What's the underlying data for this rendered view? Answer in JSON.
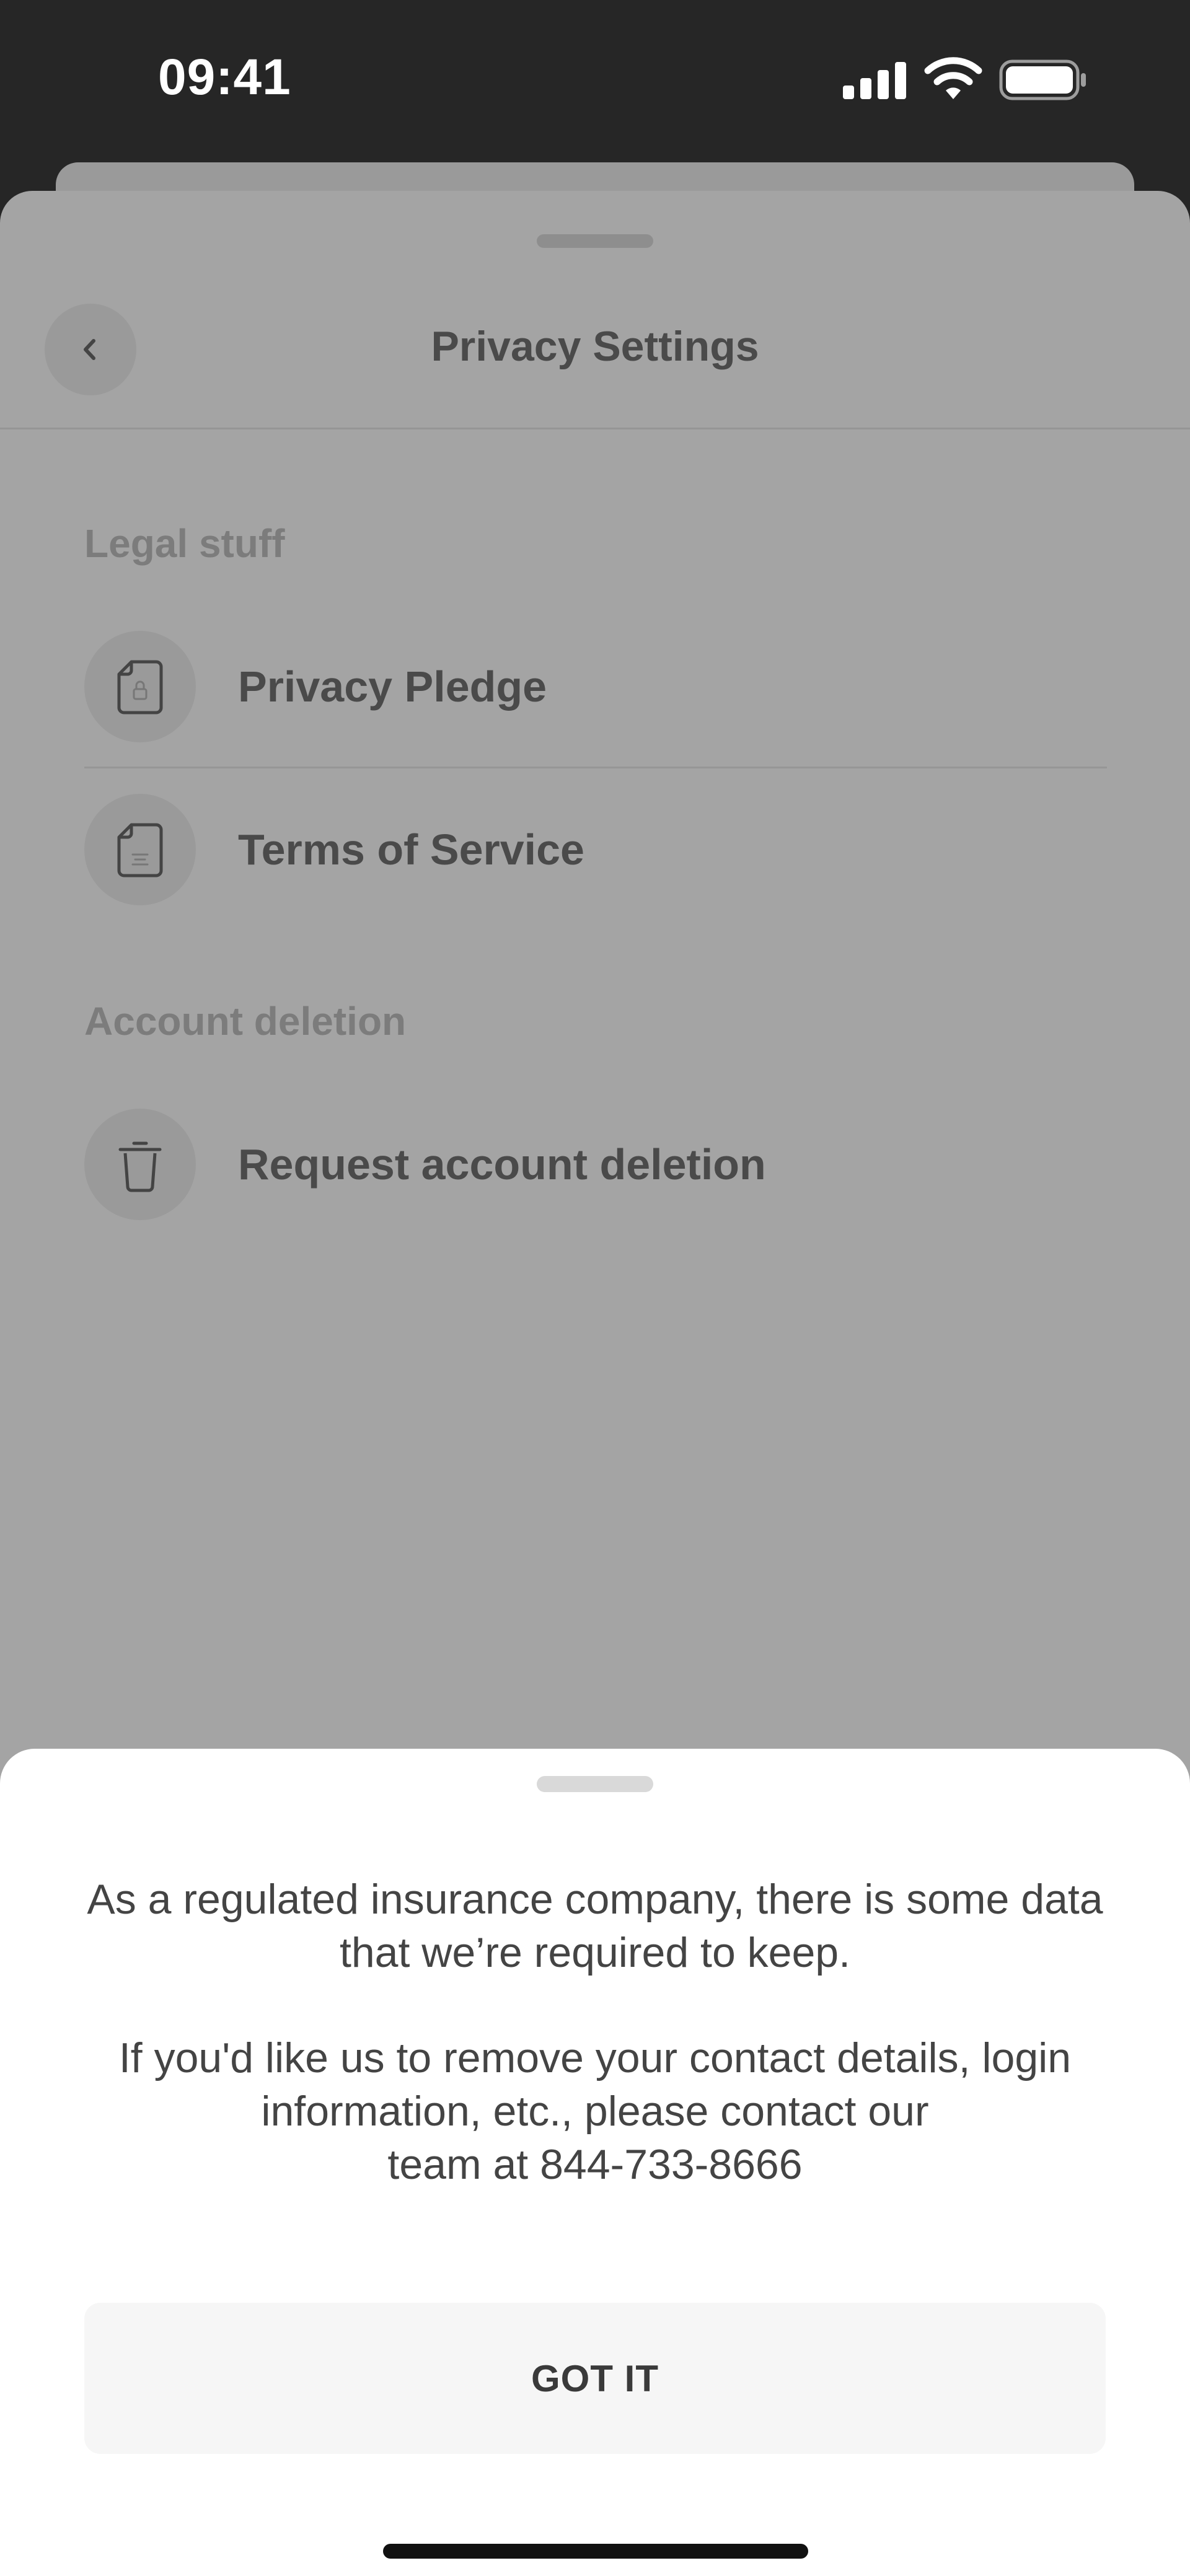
{
  "status_bar": {
    "time": "09:41",
    "icons": [
      "signal-icon",
      "wifi-icon",
      "battery-icon"
    ]
  },
  "header": {
    "back_icon": "chevron-left-icon",
    "title": "Privacy Settings"
  },
  "sections": [
    {
      "heading": "Legal stuff",
      "items": [
        {
          "label": "Privacy Pledge",
          "icon": "document-lock-icon"
        },
        {
          "label": "Terms of Service",
          "icon": "document-text-icon"
        }
      ]
    },
    {
      "heading": "Account deletion",
      "items": [
        {
          "label": "Request account deletion",
          "icon": "trash-icon"
        }
      ]
    }
  ],
  "bottom_sheet": {
    "message_1": [
      "As a regulated insurance company, there is some data",
      "that we’re required to keep."
    ],
    "message_2": [
      "If you'd like us to remove your contact details, login",
      "information, etc., please contact our",
      "team at 844-733-8666"
    ],
    "button_label": "GOT IT"
  },
  "colors": {
    "status_bar_bg": "#262626",
    "overlay_sheet": "#a4a4a4",
    "bottom_sheet_bg": "#ffffff",
    "button_bg": "#f6f6f6",
    "text_dark": "#444444"
  }
}
